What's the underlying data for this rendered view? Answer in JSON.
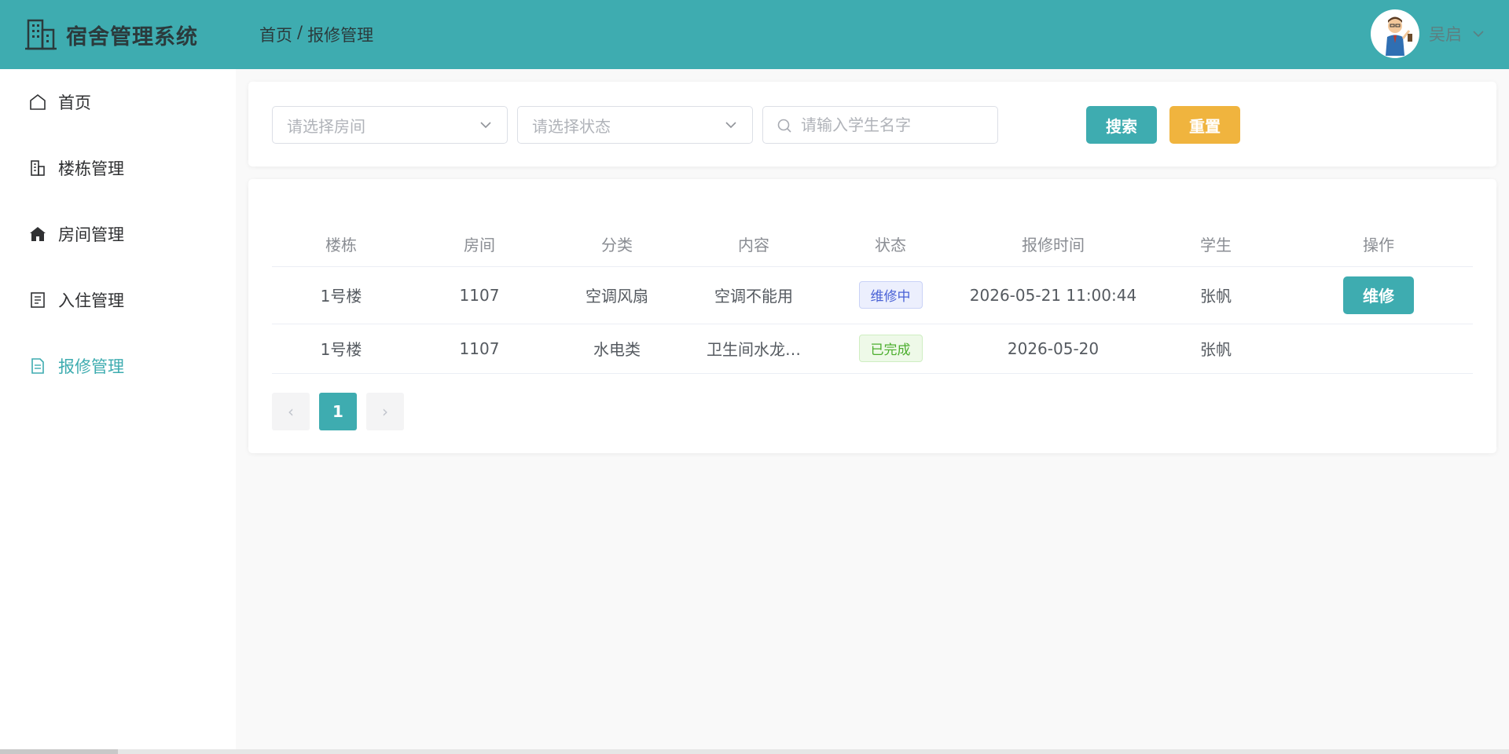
{
  "app": {
    "title": "宿舍管理系统"
  },
  "breadcrumb": {
    "home": "首页",
    "separator": "/",
    "current": "报修管理"
  },
  "user": {
    "name": "吴启"
  },
  "sidebar": {
    "items": [
      {
        "label": "首页",
        "icon": "home-icon"
      },
      {
        "label": "楼栋管理",
        "icon": "building-icon"
      },
      {
        "label": "房间管理",
        "icon": "house-icon"
      },
      {
        "label": "入住管理",
        "icon": "document-icon"
      },
      {
        "label": "报修管理",
        "icon": "repair-document-icon",
        "active": true
      }
    ]
  },
  "search": {
    "room_placeholder": "请选择房间",
    "status_placeholder": "请选择状态",
    "student_placeholder": "请输入学生名字",
    "search_label": "搜索",
    "reset_label": "重置"
  },
  "table": {
    "headers": [
      "楼栋",
      "房间",
      "分类",
      "内容",
      "状态",
      "报修时间",
      "学生",
      "操作"
    ],
    "rows": [
      {
        "building": "1号楼",
        "room": "1107",
        "category": "空调风扇",
        "content": "空调不能用",
        "status": "维修中",
        "time": "2026-05-21 11:00:44",
        "student": "张帆",
        "action": "维修"
      },
      {
        "building": "1号楼",
        "room": "1107",
        "category": "水电类",
        "content": "卫生间水龙…",
        "status": "已完成",
        "time": "2026-05-20",
        "student": "张帆",
        "action": ""
      }
    ]
  },
  "pagination": {
    "current_page": "1",
    "prev": "‹",
    "next": "›"
  },
  "colors": {
    "primary": "#3eacb0",
    "warning": "#f0b43e"
  }
}
